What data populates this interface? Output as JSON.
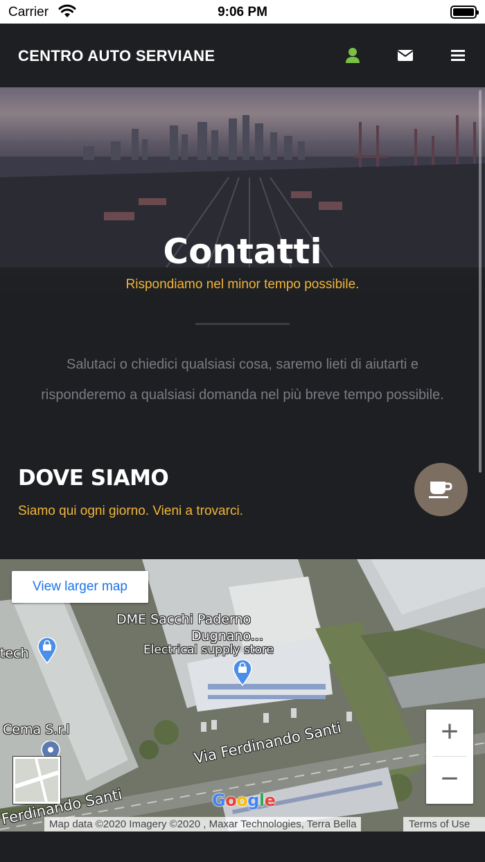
{
  "status_bar": {
    "carrier": "Carrier",
    "time": "9:06 PM"
  },
  "navbar": {
    "brand": "CENTRO AUTO SERVIANE",
    "icons": [
      "user-icon",
      "mail-icon",
      "menu-icon"
    ],
    "user_icon_color": "#7ac043"
  },
  "hero": {
    "title": "Contatti",
    "subtitle": "Rispondiamo nel minor tempo possibile."
  },
  "intro": {
    "text": "Salutaci o chiedici qualsiasi cosa, saremo lieti di aiutarti e risponderemo a qualsiasi domanda nel più breve tempo possibile."
  },
  "location": {
    "title": "DOVE SIAMO",
    "subtitle": "Siamo qui ogni giorno. Vieni a trovarci."
  },
  "floating_button": {
    "icon": "coffee-cup-icon",
    "color": "#7d6e62"
  },
  "map": {
    "larger_map_label": "View larger map",
    "labels": {
      "place1_line1": "DME Sacchi Paderno",
      "place1_line2": "Dugnano...",
      "place1_category": "Electrical supply store",
      "place2": "tech",
      "place3": "Cema S.r.l",
      "street1": "Via Ferdinando Santi",
      "street2": "Ferdinando Santi"
    },
    "zoom_in": "+",
    "zoom_out": "−",
    "logo": "Google",
    "attribution": "Map data ©2020 Imagery ©2020 , Maxar Technologies, Terra Bella",
    "terms": "Terms of Use"
  },
  "colors": {
    "background": "#1d1f22",
    "accent": "#f2b53a",
    "link": "#1a73e8"
  }
}
